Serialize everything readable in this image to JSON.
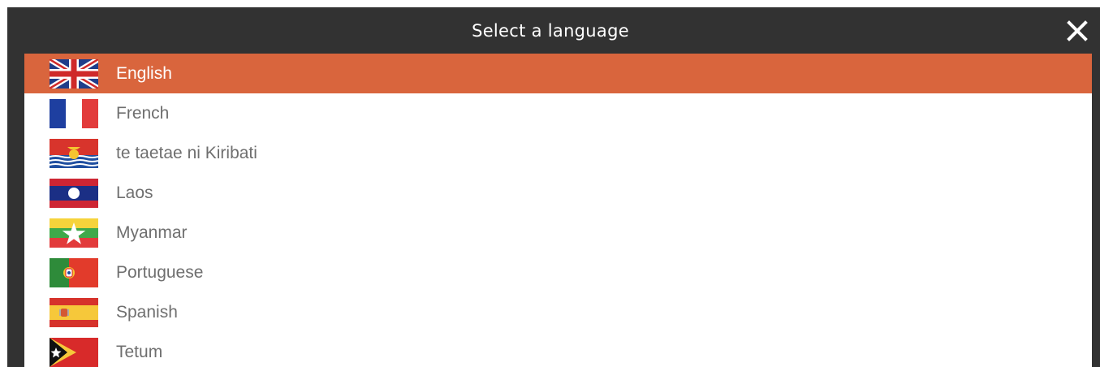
{
  "dialog": {
    "title": "Select a language",
    "close_icon": "close-icon"
  },
  "colors": {
    "titlebar": "#323232",
    "selected_row": "#d9653d",
    "label_text": "#6f6f6f"
  },
  "languages": [
    {
      "label": "English",
      "flag": "uk-flag-icon",
      "selected": true
    },
    {
      "label": "French",
      "flag": "france-flag-icon",
      "selected": false
    },
    {
      "label": "te taetae ni Kiribati",
      "flag": "kiribati-flag-icon",
      "selected": false
    },
    {
      "label": "Laos",
      "flag": "laos-flag-icon",
      "selected": false
    },
    {
      "label": "Myanmar",
      "flag": "myanmar-flag-icon",
      "selected": false
    },
    {
      "label": "Portuguese",
      "flag": "portugal-flag-icon",
      "selected": false
    },
    {
      "label": "Spanish",
      "flag": "spain-flag-icon",
      "selected": false
    },
    {
      "label": "Tetum",
      "flag": "timor-leste-flag-icon",
      "selected": false
    }
  ]
}
